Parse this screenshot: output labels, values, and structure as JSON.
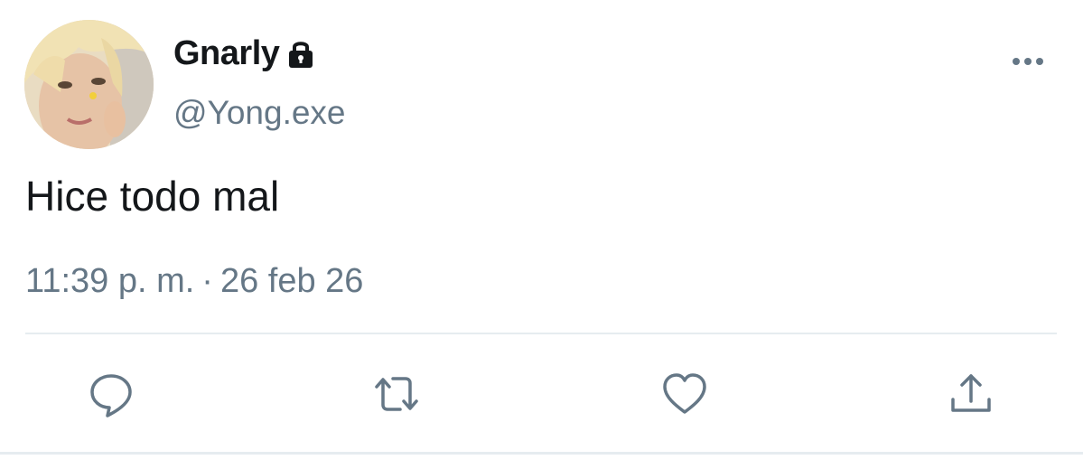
{
  "tweet": {
    "display_name": "Gnarly",
    "handle": "@Yong.exe",
    "text": "Hice todo mal",
    "time": "11:39 p. m.",
    "separator": "·",
    "date": "26 feb 26",
    "protected": true
  },
  "icons": {
    "lock": "lock-icon",
    "more": "more-horizontal-icon",
    "reply": "reply-icon",
    "retweet": "retweet-icon",
    "like": "heart-icon",
    "share": "share-icon"
  },
  "colors": {
    "primary_text": "#14171a",
    "secondary_text": "#657786",
    "divider": "#e6ecf0",
    "background": "#ffffff"
  }
}
